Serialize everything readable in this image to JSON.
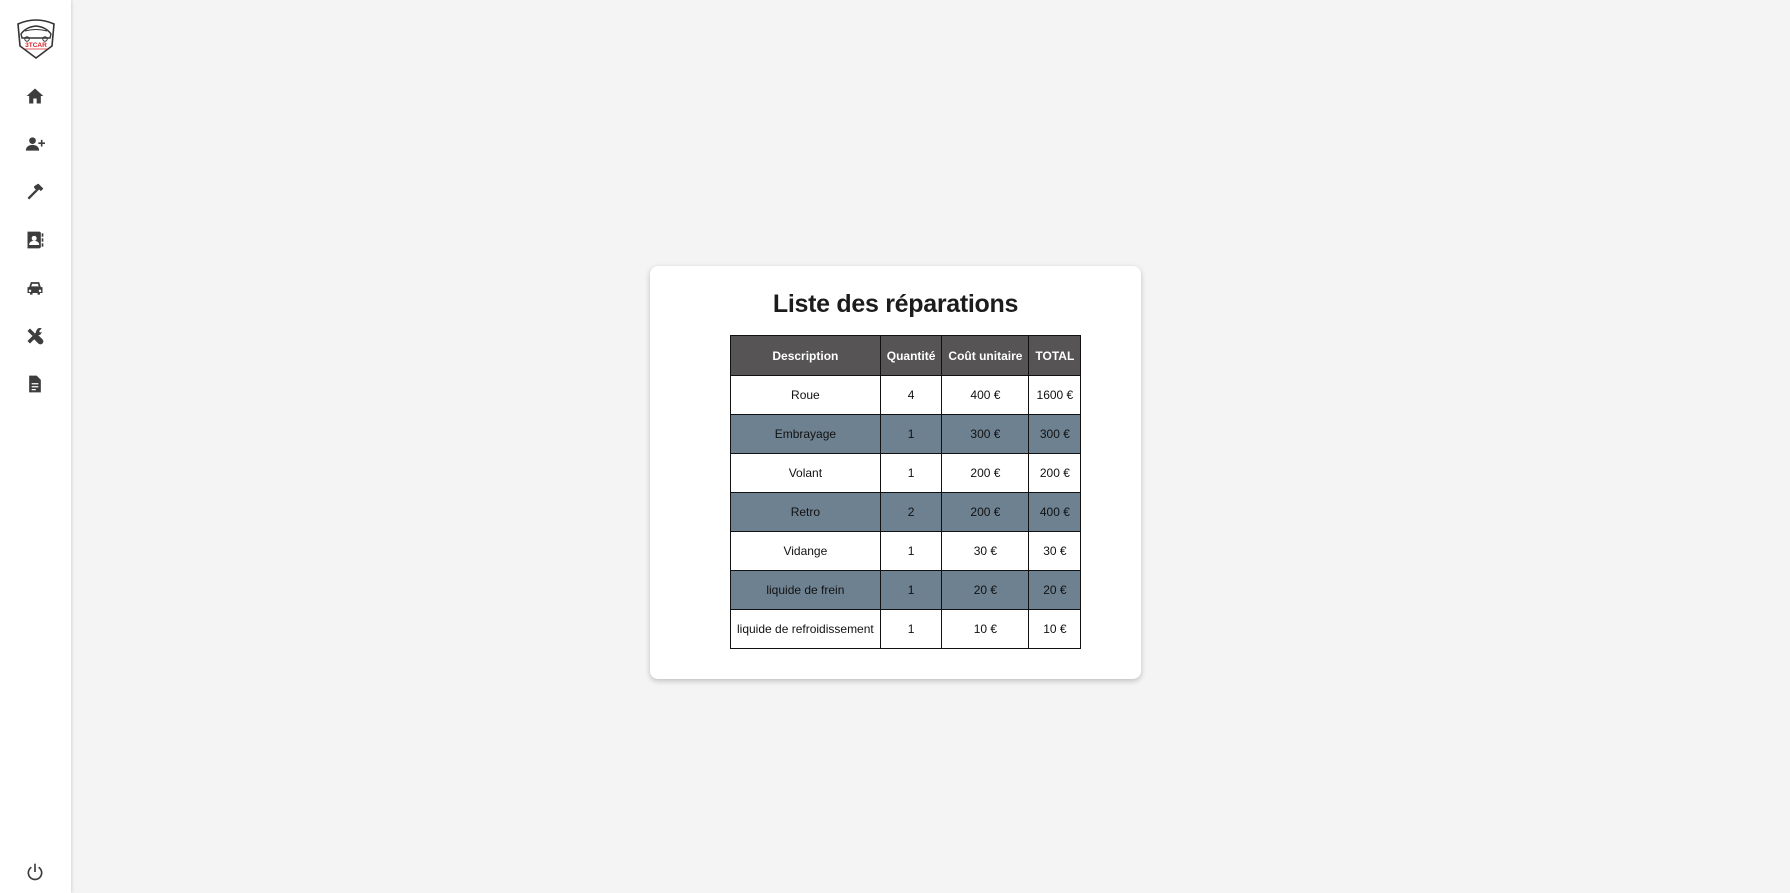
{
  "logo": {
    "text": "3TCAR"
  },
  "sidebar": {
    "items": [
      {
        "icon": "home-icon"
      },
      {
        "icon": "add-user-icon"
      },
      {
        "icon": "hammer-icon"
      },
      {
        "icon": "contacts-icon"
      },
      {
        "icon": "car-icon"
      },
      {
        "icon": "tools-icon"
      },
      {
        "icon": "document-icon"
      }
    ],
    "logout_icon": "power-icon"
  },
  "card": {
    "title": "Liste des réparations",
    "table": {
      "headers": [
        "Description",
        "Quantité",
        "Coût unitaire",
        "TOTAL"
      ],
      "rows": [
        [
          "Roue",
          "4",
          "400 €",
          "1600 €"
        ],
        [
          "Embrayage",
          "1",
          "300 €",
          "300 €"
        ],
        [
          "Volant",
          "1",
          "200 €",
          "200 €"
        ],
        [
          "Retro",
          "2",
          "200 €",
          "400 €"
        ],
        [
          "Vidange",
          "1",
          "30 €",
          "30 €"
        ],
        [
          "liquide de frein",
          "1",
          "20 €",
          "20 €"
        ],
        [
          "liquide de refroidissement",
          "1",
          "10 €",
          "10 €"
        ]
      ]
    }
  },
  "colors": {
    "header_bg": "#565454",
    "alt_row_bg": "#6e8191",
    "background": "#f4f4f4",
    "logo_accent": "#d8232a"
  }
}
